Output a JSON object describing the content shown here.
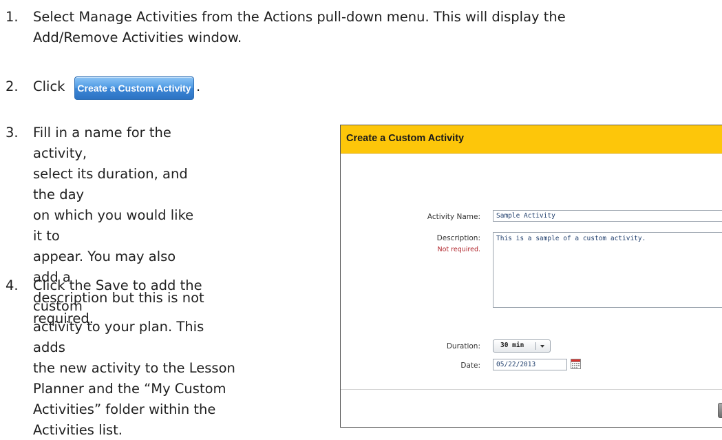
{
  "steps": [
    {
      "num": "1.",
      "lines": [
        "Select Manage Activities from the Actions pull-down menu. This will display the",
        "Add/Remove Activities window."
      ]
    },
    {
      "num": "2.",
      "lines": [
        "Click"
      ],
      "button_label": "Create a Custom Activity",
      "trailing": "."
    },
    {
      "num": "3.",
      "lines": [
        "Fill in a name for the activity,",
        "select its duration, and the day",
        "on which you would like it to",
        "appear. You may also add a",
        "description but this is not",
        "required."
      ]
    },
    {
      "num": "4.",
      "lines": [
        "Click the Save to add the custom",
        "activity to your plan. This adds",
        "the new activity to the Lesson",
        "Planner and the “My Custom",
        "Activities” folder within the",
        "Activities list."
      ]
    }
  ],
  "dialog": {
    "title": "Create a Custom Activity",
    "activity_name_label": "Activity Name:",
    "activity_name_value": "Sample Activity",
    "description_label": "Description:",
    "description_note": "Not required.",
    "description_value": "This is a sample of a custom activity.",
    "duration_label": "Duration:",
    "duration_value": "30 min",
    "date_label": "Date:",
    "date_value": "05/22/2013"
  },
  "icons": {
    "dropdown": "chevron-down-icon",
    "calendar": "calendar-icon"
  },
  "colors": {
    "header_bg": "#fdc60a",
    "button_blue": "#3b86d6",
    "note_red": "#b0232a",
    "input_text": "#1e3d6b"
  }
}
